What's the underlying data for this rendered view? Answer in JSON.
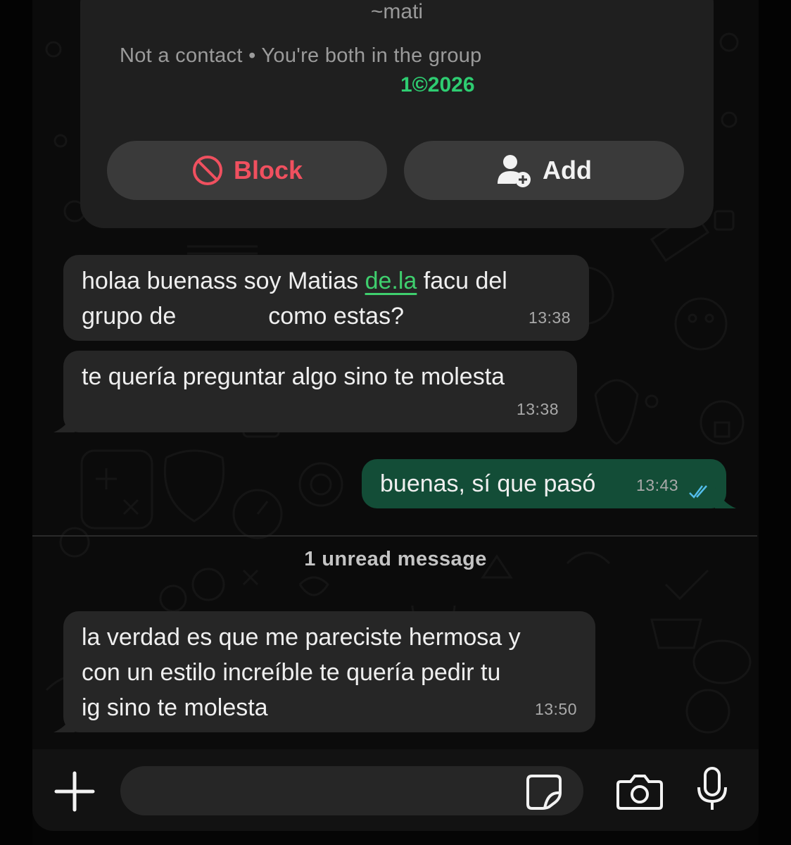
{
  "contact": {
    "name": "~mati",
    "status": "Not a contact • You're both in the group",
    "group_name": "1©2026"
  },
  "actions": {
    "block_label": "Block",
    "add_label": "Add"
  },
  "messages": [
    {
      "direction": "incoming",
      "line1_part1": "holaa buenass soy Matias ",
      "line1_link": "de.la",
      "line1_part2": " facu del",
      "line2_part1": "grupo  de",
      "line2_part2": "como estas?",
      "time": "13:38"
    },
    {
      "direction": "incoming",
      "text": "te quería preguntar algo sino te molesta",
      "time": "13:38"
    },
    {
      "direction": "outgoing",
      "text": "buenas, sí que pasó",
      "time": "13:43",
      "read_icon": "double-check-icon"
    },
    {
      "direction": "incoming",
      "line1": "la verdad es que me pareciste hermosa y",
      "line2": "con un estilo increíble te quería pedir tu",
      "line3": "ig sino te molesta",
      "time": "13:50"
    }
  ],
  "unread_divider": "1 unread message",
  "composer": {
    "value": "",
    "icons": [
      "plus-icon",
      "sticker-icon",
      "camera-icon",
      "microphone-icon"
    ]
  },
  "colors": {
    "incoming_bubble": "#262626",
    "outgoing_bubble": "#134d37",
    "link": "#3fcf6e",
    "block_red": "#f0505f",
    "read_check": "#53bdeb"
  }
}
